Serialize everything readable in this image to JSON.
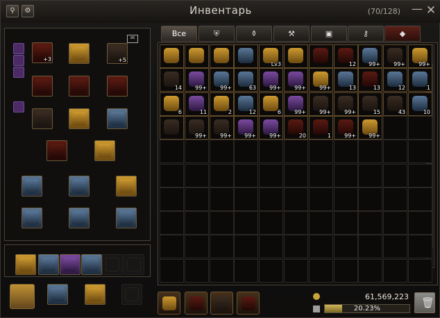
{
  "window": {
    "title": "Инвентарь",
    "capacity": "(70/128)"
  },
  "header": {
    "left_buttons": [
      "search-icon",
      "settings-icon"
    ]
  },
  "tabs": [
    {
      "label": "Все",
      "active": true
    },
    {
      "label": "",
      "icon": "helmet-icon"
    },
    {
      "label": "",
      "icon": "potion-icon"
    },
    {
      "label": "",
      "icon": "hammer-icon"
    },
    {
      "label": "",
      "icon": "box-icon"
    },
    {
      "label": "",
      "icon": "key-icon"
    },
    {
      "label": "",
      "icon": "diamond-icon"
    }
  ],
  "equipment": {
    "counts": [
      "+3",
      "+5"
    ]
  },
  "inventory": {
    "badge": "Lv3",
    "rows": [
      [
        {
          "n": "",
          "c": "gold"
        },
        {
          "n": "",
          "c": "gold"
        },
        {
          "n": "",
          "c": "gold"
        },
        {
          "n": "",
          "c": "blue"
        },
        {
          "n": "Lv3",
          "c": "gold"
        },
        {
          "n": "",
          "c": "gold"
        },
        {
          "n": "",
          "c": "red"
        },
        {
          "n": "12",
          "c": "red"
        },
        {
          "n": "99+",
          "c": "blue"
        },
        {
          "n": "99+",
          "c": "dark"
        },
        {
          "n": "99+",
          "c": "gold"
        }
      ],
      [
        {
          "n": "14",
          "c": "dark"
        },
        {
          "n": "99+",
          "c": "purple"
        },
        {
          "n": "99+",
          "c": "blue"
        },
        {
          "n": "63",
          "c": "blue"
        },
        {
          "n": "99+",
          "c": "purple"
        },
        {
          "n": "99+",
          "c": "purple"
        },
        {
          "n": "99+",
          "c": "gold"
        },
        {
          "n": "13",
          "c": "blue"
        },
        {
          "n": "13",
          "c": "red"
        },
        {
          "n": "12",
          "c": "blue"
        },
        {
          "n": "1",
          "c": "blue"
        }
      ],
      [
        {
          "n": "6",
          "c": "gold"
        },
        {
          "n": "11",
          "c": "purple"
        },
        {
          "n": "2",
          "c": "gold"
        },
        {
          "n": "12",
          "c": "blue"
        },
        {
          "n": "6",
          "c": "gold"
        },
        {
          "n": "99+",
          "c": "purple"
        },
        {
          "n": "99+",
          "c": "dark"
        },
        {
          "n": "99+",
          "c": "dark"
        },
        {
          "n": "15",
          "c": "dark"
        },
        {
          "n": "43",
          "c": "dark"
        },
        {
          "n": "10",
          "c": "blue"
        }
      ],
      [
        {
          "n": "",
          "c": "dark"
        },
        {
          "n": "99+",
          "c": "dark"
        },
        {
          "n": "99+",
          "c": "dark"
        },
        {
          "n": "99+",
          "c": "purple"
        },
        {
          "n": "99+",
          "c": "purple"
        },
        {
          "n": "20",
          "c": "red"
        },
        {
          "n": "1",
          "c": "red"
        },
        {
          "n": "99+",
          "c": "red"
        },
        {
          "n": "99+",
          "c": "gold"
        }
      ]
    ]
  },
  "bottom_bar": {
    "currency": "61,569,223",
    "progress_label": "20.23%",
    "progress": 0.2023
  }
}
